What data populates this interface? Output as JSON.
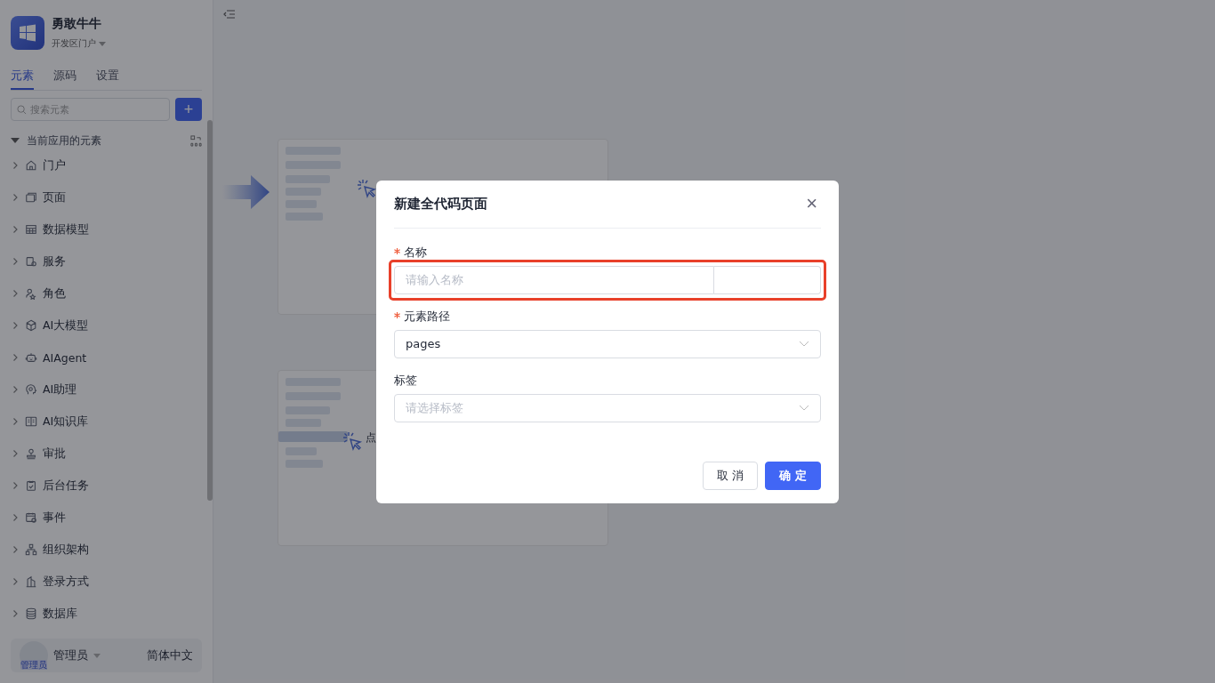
{
  "app": {
    "name": "勇敢牛牛",
    "portal": "开发区门户"
  },
  "tabs": [
    {
      "label": "元素",
      "selected": true
    },
    {
      "label": "源码",
      "selected": false
    },
    {
      "label": "设置",
      "selected": false
    }
  ],
  "search": {
    "placeholder": "搜索元素"
  },
  "add_button": "+",
  "tree": {
    "label": "当前应用的元素",
    "expanded": true,
    "children": [
      {
        "label": "门户",
        "expanded": false
      },
      {
        "label": "页面",
        "expanded": false
      },
      {
        "label": "数据模型",
        "expanded": false
      },
      {
        "label": "服务",
        "expanded": false
      },
      {
        "label": "角色",
        "expanded": false
      },
      {
        "label": "AI大模型",
        "expanded": false
      },
      {
        "label": "AIAgent",
        "expanded": false
      },
      {
        "label": "AI助理",
        "expanded": false
      },
      {
        "label": "AI知识库",
        "expanded": false
      },
      {
        "label": "审批",
        "expanded": false
      },
      {
        "label": "后台任务",
        "expanded": false
      },
      {
        "label": "事件",
        "expanded": false
      },
      {
        "label": "组织架构",
        "expanded": false
      },
      {
        "label": "登录方式",
        "expanded": false
      },
      {
        "label": "数据库",
        "expanded": false
      }
    ]
  },
  "footer": {
    "avatar_label": "管理员",
    "user": "管理员",
    "language": "简体中文"
  },
  "guide": {
    "hint": "点"
  },
  "dialog": {
    "title": "新建全代码页面",
    "close": "×",
    "fields": [
      {
        "kind": "input",
        "label": "名称",
        "required": true,
        "placeholder": "请输入名称",
        "highlighted": true
      },
      {
        "kind": "select",
        "label": "元素路径",
        "required": true,
        "value": "pages",
        "highlighted": false
      },
      {
        "kind": "select",
        "label": "标签",
        "required": false,
        "placeholder": "请选择标签",
        "highlighted": false
      }
    ],
    "buttons": [
      {
        "label": "取 消",
        "primary": false
      },
      {
        "label": "确 定",
        "primary": true
      }
    ]
  }
}
